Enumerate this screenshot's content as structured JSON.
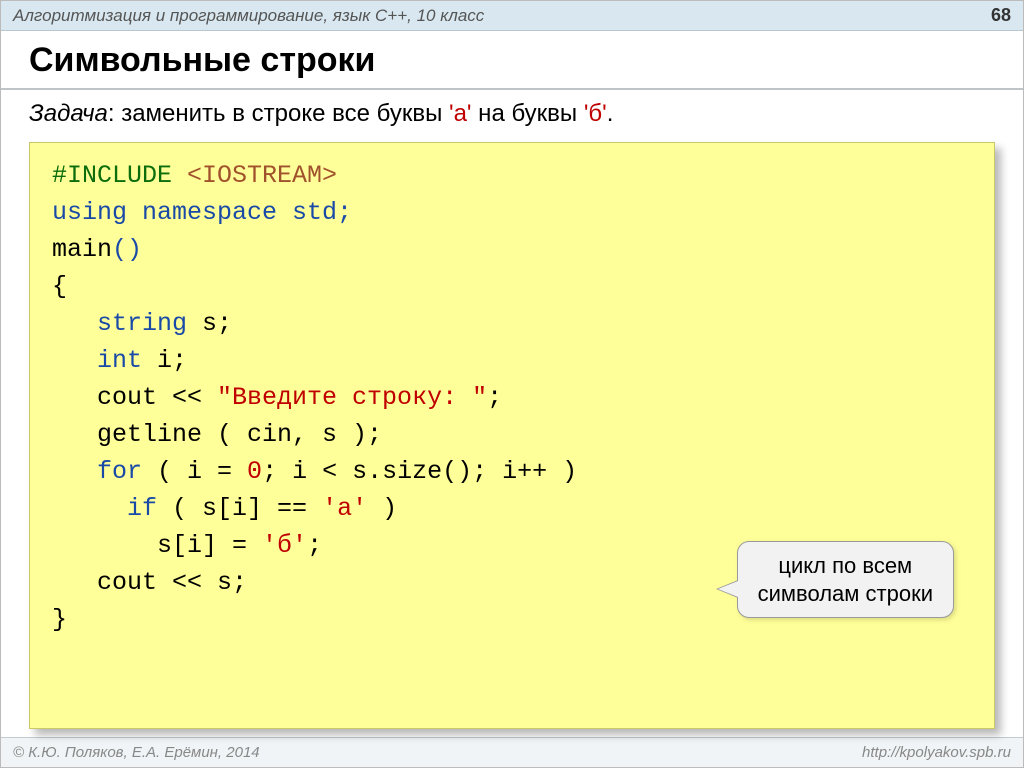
{
  "topbar": {
    "course": "Алгоритмизация и программирование, язык C++, 10 класс",
    "page": "68"
  },
  "title": "Символьные строки",
  "task": {
    "label": "Задача",
    "before": ": заменить в строке все буквы ",
    "chr1": "'а'",
    "middle": " на буквы ",
    "chr2": "'б'",
    "after": "."
  },
  "code": {
    "l1a": "#INCLUDE ",
    "l1b": "<IOSTREAM>",
    "l2": "using namespace std;",
    "l3a": "main",
    "l3b": "()",
    "l4": "{",
    "l5a": "   string",
    "l5b": " s;",
    "l6a": "   int ",
    "l6b": "i;",
    "l7a": "   cout << ",
    "l7b": "\"Введите строку: \"",
    "l7c": ";",
    "l8": "   getline ( cin, s );",
    "l9a": "   for",
    "l9b": " ( i = ",
    "l9c": "0",
    "l9d": "; i < s.size(); i++ )",
    "l10a": "     if",
    "l10b": " ( s[i] == ",
    "l10c": "'а'",
    "l10d": " )",
    "l11a": "       s[i] = ",
    "l11b": "'б'",
    "l11c": ";",
    "l12": "   cout << s;",
    "l13": "}"
  },
  "callout": {
    "line1": "цикл по всем",
    "line2": "символам строки"
  },
  "footer": {
    "left": "© К.Ю. Поляков, Е.А. Ерёмин, 2014",
    "right": "http://kpolyakov.spb.ru"
  }
}
